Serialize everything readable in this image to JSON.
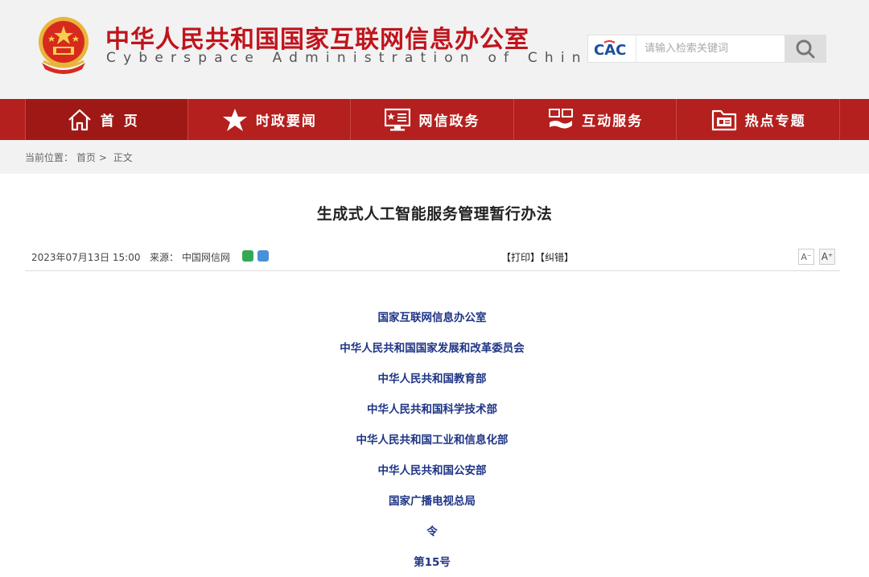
{
  "header": {
    "title": "中华人民共和国国家互联网信息办公室",
    "subtitle": "Cyberspace Administration of China",
    "cac_logo_text": "CAC"
  },
  "search": {
    "placeholder": "请输入检索关键词"
  },
  "nav": {
    "items": [
      {
        "label": "首页",
        "icon": "home-icon"
      },
      {
        "label": "时政要闻",
        "icon": "star-icon"
      },
      {
        "label": "网信政务",
        "icon": "monitor-icon"
      },
      {
        "label": "互动服务",
        "icon": "handshake-icon"
      },
      {
        "label": "热点专题",
        "icon": "folder-icon"
      }
    ]
  },
  "breadcrumb": {
    "label": "当前位置：",
    "home": "首页",
    "separator": ">",
    "current": "正文"
  },
  "article": {
    "title": "生成式人工智能服务管理暂行办法",
    "date": "2023年07月13日 15:00",
    "source_label": "来源：",
    "source": "中国网信网",
    "print": "【打印】",
    "correction": "【纠错】",
    "font_small": "A⁻",
    "font_large": "A⁺",
    "issuers": [
      "国家互联网信息办公室",
      "中华人民共和国国家发展和改革委员会",
      "中华人民共和国教育部",
      "中华人民共和国科学技术部",
      "中华人民共和国工业和信息化部",
      "中华人民共和国公安部",
      "国家广播电视总局",
      "令",
      "第15号"
    ]
  },
  "colors": {
    "brand_red": "#c0141c",
    "nav_red": "#b4201e",
    "issuer_blue": "#1f3585"
  }
}
